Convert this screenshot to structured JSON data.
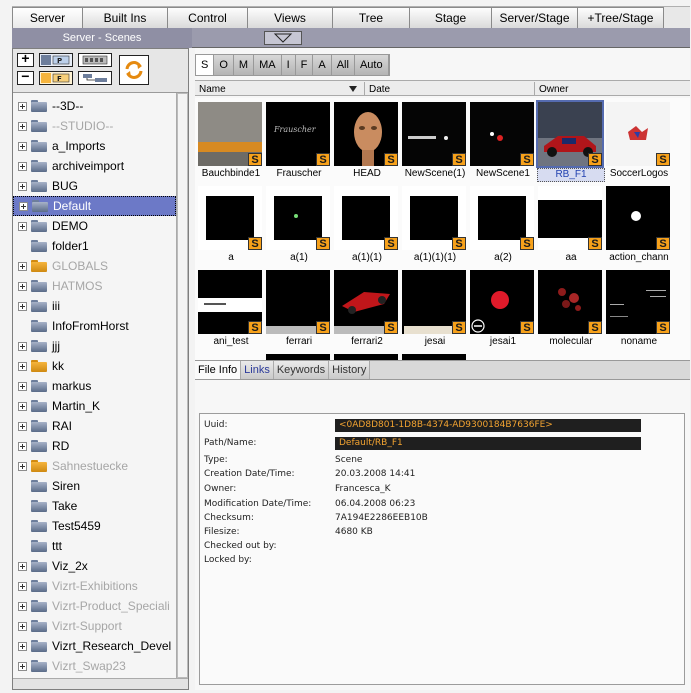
{
  "tabs": [
    {
      "label": "Server",
      "active": true
    },
    {
      "label": "Built Ins"
    },
    {
      "label": "Control"
    },
    {
      "label": "Views"
    },
    {
      "label": "Tree"
    },
    {
      "label": "Stage"
    },
    {
      "label": "Server/Stage"
    },
    {
      "label": "+Tree/Stage"
    }
  ],
  "scene_bar": {
    "title": "Server - Scenes"
  },
  "toolbar": {
    "buttons": [
      {
        "name": "add-button",
        "glyph": "+"
      },
      {
        "name": "remove-button",
        "glyph": "−"
      },
      {
        "name": "folder-project-button",
        "glyph": "P"
      },
      {
        "name": "folder-favorite-button",
        "glyph": "F"
      },
      {
        "name": "film-strip-button",
        "glyph": ""
      },
      {
        "name": "tree-view-button",
        "glyph": ""
      },
      {
        "name": "refresh-button",
        "glyph": ""
      }
    ]
  },
  "tree": {
    "items": [
      {
        "label": "--3D--",
        "expand": true,
        "folder": "blue",
        "grey": false
      },
      {
        "label": "--STUDIO--",
        "expand": true,
        "folder": "blue",
        "grey": true
      },
      {
        "label": "a_Imports",
        "expand": true,
        "folder": "blue",
        "grey": false
      },
      {
        "label": "archiveimport",
        "expand": true,
        "folder": "blue",
        "grey": false
      },
      {
        "label": "BUG",
        "expand": true,
        "folder": "blue",
        "grey": false
      },
      {
        "label": "Default",
        "expand": true,
        "folder": "blue",
        "grey": false,
        "selected": true
      },
      {
        "label": "DEMO",
        "expand": true,
        "folder": "blue",
        "grey": false
      },
      {
        "label": "folder1",
        "expand": false,
        "folder": "blue",
        "grey": false
      },
      {
        "label": "GLOBALS",
        "expand": true,
        "folder": "orange",
        "grey": true
      },
      {
        "label": "HATMOS",
        "expand": true,
        "folder": "blue",
        "grey": true
      },
      {
        "label": "iii",
        "expand": true,
        "folder": "blue",
        "grey": false
      },
      {
        "label": "InfoFromHorst",
        "expand": false,
        "folder": "blue",
        "grey": false
      },
      {
        "label": "jjj",
        "expand": true,
        "folder": "blue",
        "grey": false
      },
      {
        "label": "kk",
        "expand": true,
        "folder": "orange",
        "grey": false
      },
      {
        "label": "markus",
        "expand": true,
        "folder": "blue",
        "grey": false
      },
      {
        "label": "Martin_K",
        "expand": true,
        "folder": "blue",
        "grey": false
      },
      {
        "label": "RAI",
        "expand": true,
        "folder": "blue",
        "grey": false
      },
      {
        "label": "RD",
        "expand": true,
        "folder": "blue",
        "grey": false
      },
      {
        "label": "Sahnestuecke",
        "expand": true,
        "folder": "orange",
        "grey": true
      },
      {
        "label": "Siren",
        "expand": false,
        "folder": "blue",
        "grey": false
      },
      {
        "label": "Take",
        "expand": false,
        "folder": "blue",
        "grey": false
      },
      {
        "label": "Test5459",
        "expand": false,
        "folder": "blue",
        "grey": false
      },
      {
        "label": "ttt",
        "expand": false,
        "folder": "blue",
        "grey": false
      },
      {
        "label": "Viz_2x",
        "expand": true,
        "folder": "blue",
        "grey": false
      },
      {
        "label": "Vizrt-Exhibitions",
        "expand": true,
        "folder": "blue",
        "grey": true
      },
      {
        "label": "Vizrt-Product_Speciali",
        "expand": true,
        "folder": "blue",
        "grey": true
      },
      {
        "label": "Vizrt-Support",
        "expand": true,
        "folder": "blue",
        "grey": true
      },
      {
        "label": "Vizrt_Research_Devel",
        "expand": true,
        "folder": "blue",
        "grey": false
      },
      {
        "label": "Vizrt_Swap23",
        "expand": true,
        "folder": "blue",
        "grey": true
      }
    ]
  },
  "filters": [
    "S",
    "O",
    "M",
    "MA",
    "I",
    "F",
    "A",
    "All",
    "Auto"
  ],
  "active_filter": "S",
  "columns": [
    "Name",
    "Date",
    "Owner"
  ],
  "thumbnails": [
    {
      "label": "Bauchbinde1",
      "art": "bauch"
    },
    {
      "label": "Frauscher",
      "art": "frau"
    },
    {
      "label": "HEAD",
      "art": "head"
    },
    {
      "label": "NewScene(1)",
      "art": "ns1"
    },
    {
      "label": "NewScene1",
      "art": "ns2"
    },
    {
      "label": "RB_F1",
      "art": "rb",
      "selected": true
    },
    {
      "label": "SoccerLogos",
      "art": "soccer"
    },
    {
      "label": "a",
      "art": "a1"
    },
    {
      "label": "a(1)",
      "art": "a2"
    },
    {
      "label": "a(1)(1)",
      "art": "a3"
    },
    {
      "label": "a(1)(1)(1)",
      "art": "a4"
    },
    {
      "label": "a(2)",
      "art": "a5"
    },
    {
      "label": "aa",
      "art": "aa"
    },
    {
      "label": "action_chann",
      "art": "action"
    },
    {
      "label": "ani_test",
      "art": "ani"
    },
    {
      "label": "ferrari",
      "art": "ferrari"
    },
    {
      "label": "ferrari2",
      "art": "ferrari2"
    },
    {
      "label": "jesai",
      "art": "jesai"
    },
    {
      "label": "jesai1",
      "art": "jesai1"
    },
    {
      "label": "molecular",
      "art": "molecular"
    },
    {
      "label": "noname",
      "art": "noname"
    }
  ],
  "info_tabs": [
    {
      "label": "File Info",
      "active": true
    },
    {
      "label": "Links"
    },
    {
      "label": "Keywords"
    },
    {
      "label": "History"
    }
  ],
  "file_info": [
    {
      "key": "Uuid:",
      "value": "<0AD8D801-1D8B-4374-AD9300184B7636FE>",
      "style": "dark hl"
    },
    {
      "key": "Path/Name:",
      "value": "Default/RB_F1",
      "style": "dark hl"
    },
    {
      "key": "Type:",
      "value": "Scene",
      "style": ""
    },
    {
      "key": "Creation Date/Time:",
      "value": "20.03.2008 14:41",
      "style": ""
    },
    {
      "key": "Owner:",
      "value": "Francesca_K",
      "style": ""
    },
    {
      "key": "Modification Date/Time:",
      "value": "06.04.2008 06:23",
      "style": ""
    },
    {
      "key": "Checksum:",
      "value": "7A194E2286EEB10B",
      "style": ""
    },
    {
      "key": "Filesize:",
      "value": "4680 KB",
      "style": ""
    },
    {
      "key": "Checked out by:",
      "value": "",
      "style": ""
    },
    {
      "key": "Locked by:",
      "value": "",
      "style": ""
    }
  ],
  "badge_letter": "S",
  "colors": {
    "selection": "#6c79c7",
    "badge": "#f7a11a",
    "folder_blue": "#6d7e9c",
    "folder_orange": "#f5b43d"
  }
}
